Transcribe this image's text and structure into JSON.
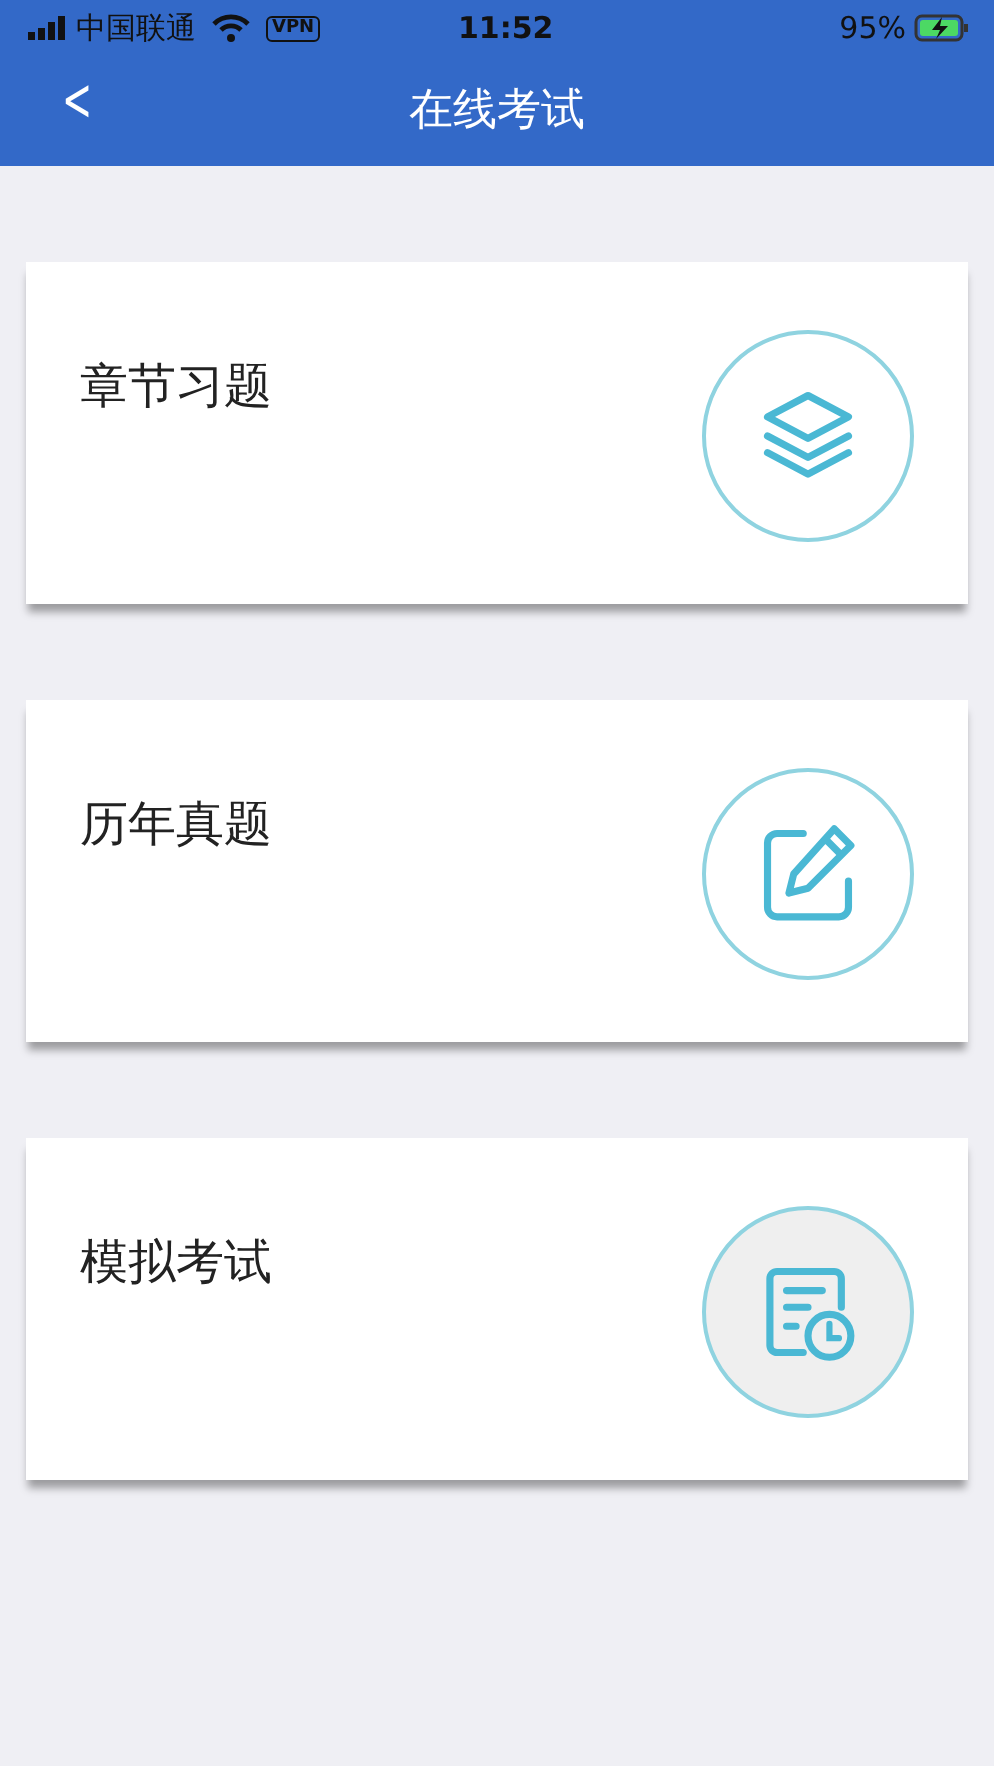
{
  "status_bar": {
    "carrier": "中国联通",
    "vpn": "VPN",
    "time": "11:52",
    "battery": "95%"
  },
  "nav_bar": {
    "back": "<",
    "title": "在线考试"
  },
  "cards": [
    {
      "title": "章节习题",
      "kind": "layers",
      "selected": false
    },
    {
      "title": "历年真题",
      "kind": "edit",
      "selected": false
    },
    {
      "title": "模拟考试",
      "kind": "timesheet",
      "selected": true
    }
  ]
}
